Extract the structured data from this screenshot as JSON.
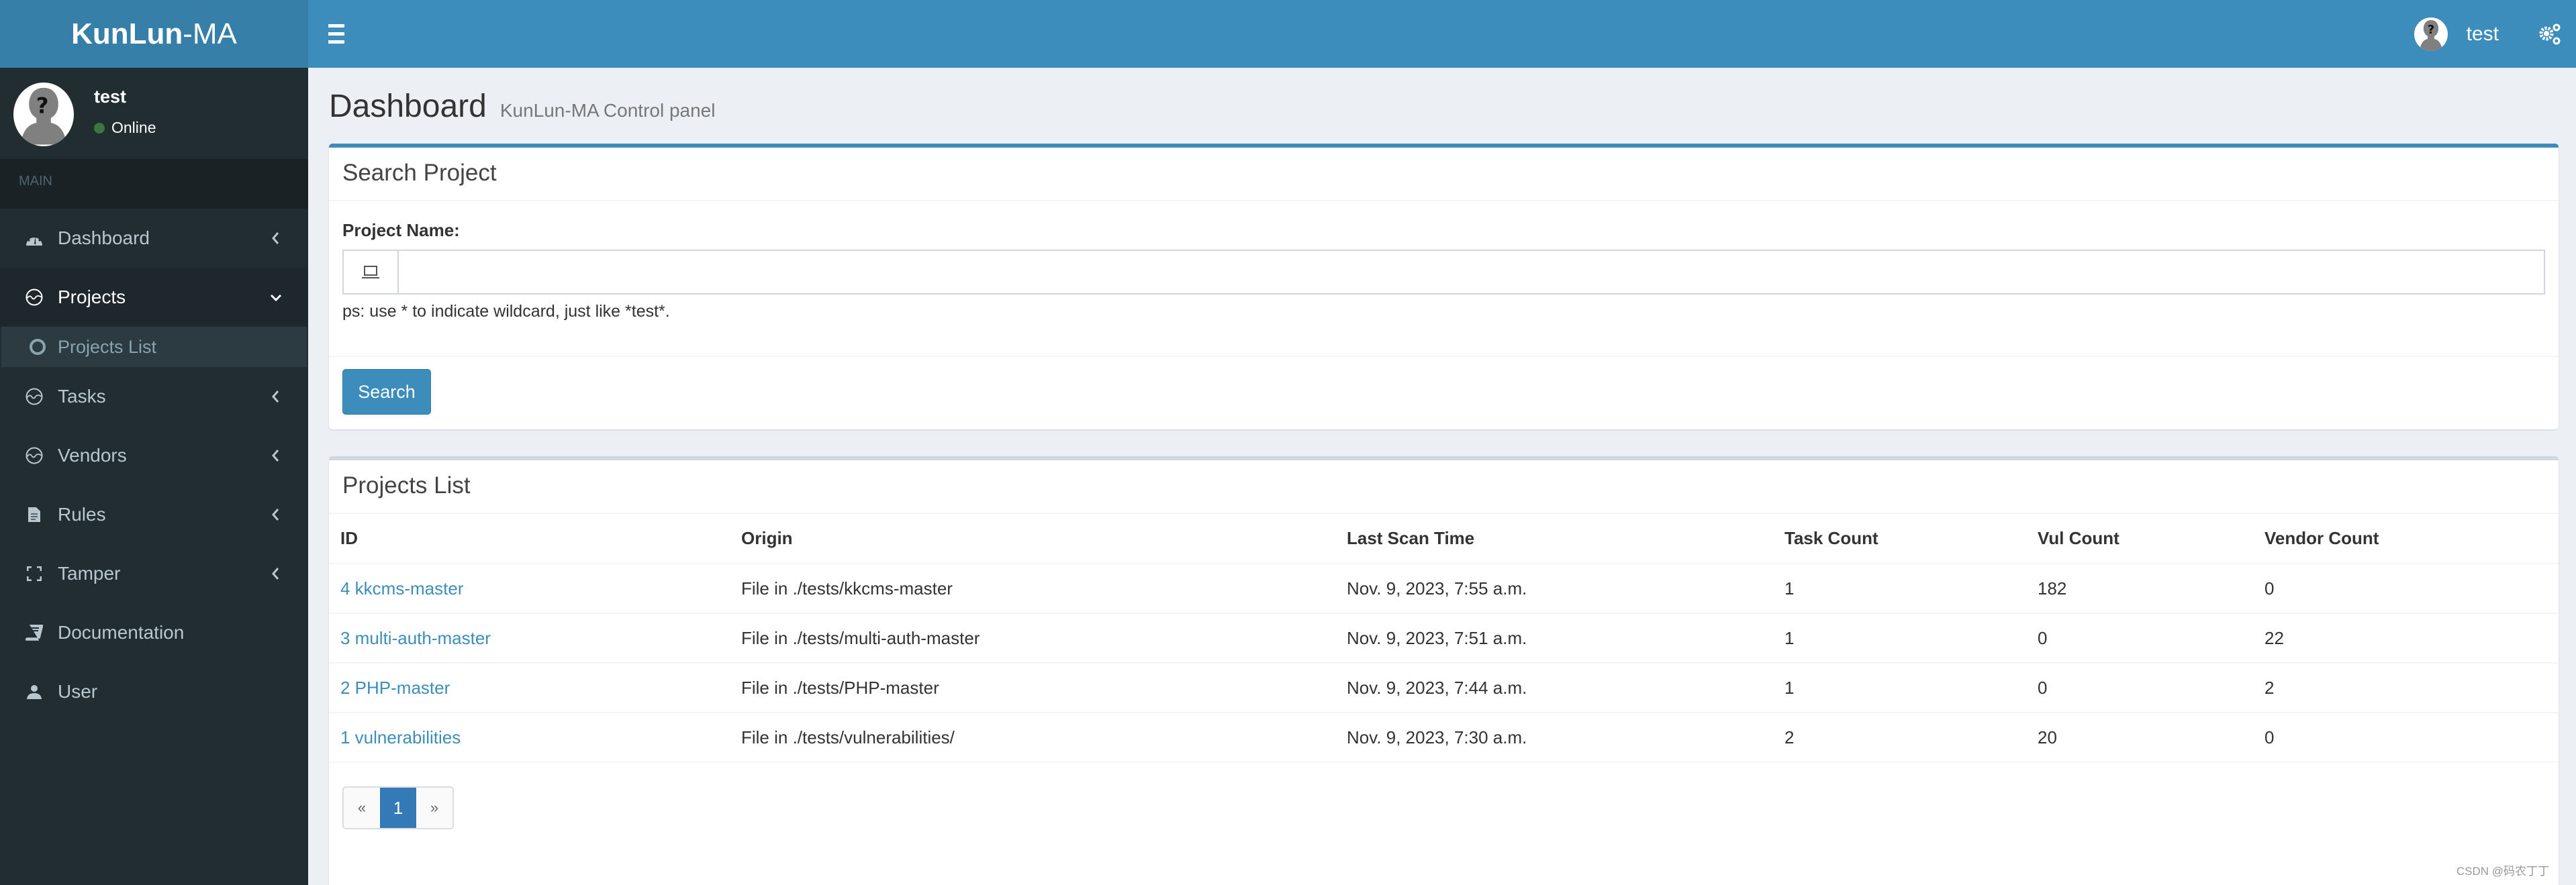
{
  "header": {
    "logo_bold": "KunLun",
    "logo_rest": "-MA",
    "username": "test",
    "menu_toggle_icon": "bars-icon",
    "settings_icon": "gears-icon"
  },
  "sidebar": {
    "user": {
      "name": "test",
      "status": "Online"
    },
    "section_header": "MAIN",
    "items": [
      {
        "label": "Dashboard",
        "icon": "dashboard-icon",
        "chevron": "left"
      },
      {
        "label": "Projects",
        "icon": "heartbeat-circle-icon",
        "chevron": "down",
        "active": true,
        "children": [
          {
            "label": "Projects List",
            "icon": "circle-icon"
          }
        ]
      },
      {
        "label": "Tasks",
        "icon": "heartbeat-circle-icon",
        "chevron": "left"
      },
      {
        "label": "Vendors",
        "icon": "heartbeat-circle-icon",
        "chevron": "left"
      },
      {
        "label": "Rules",
        "icon": "file-icon",
        "chevron": "left"
      },
      {
        "label": "Tamper",
        "icon": "fullscreen-icon",
        "chevron": "left"
      },
      {
        "label": "Documentation",
        "icon": "book-icon"
      },
      {
        "label": "User",
        "icon": "user-icon"
      }
    ]
  },
  "page": {
    "title": "Dashboard",
    "subtitle": "KunLun-MA Control panel"
  },
  "search_box": {
    "title": "Search Project",
    "field_label": "Project Name:",
    "input_value": "",
    "input_placeholder": "",
    "hint": "ps: use * to indicate wildcard, just like *test*.",
    "button_label": "Search"
  },
  "projects_box": {
    "title": "Projects List",
    "columns": [
      "ID",
      "Origin",
      "Last Scan Time",
      "Task Count",
      "Vul Count",
      "Vendor Count"
    ],
    "rows": [
      {
        "id": "4 kkcms-master",
        "origin": "File in ./tests/kkcms-master",
        "last_scan": "Nov. 9, 2023, 7:55 a.m.",
        "task_count": "1",
        "vul_count": "182",
        "vendor_count": "0"
      },
      {
        "id": "3 multi-auth-master",
        "origin": "File in ./tests/multi-auth-master",
        "last_scan": "Nov. 9, 2023, 7:51 a.m.",
        "task_count": "1",
        "vul_count": "0",
        "vendor_count": "22"
      },
      {
        "id": "2 PHP-master",
        "origin": "File in ./tests/PHP-master",
        "last_scan": "Nov. 9, 2023, 7:44 a.m.",
        "task_count": "1",
        "vul_count": "0",
        "vendor_count": "2"
      },
      {
        "id": "1 vulnerabilities",
        "origin": "File in ./tests/vulnerabilities/",
        "last_scan": "Nov. 9, 2023, 7:30 a.m.",
        "task_count": "2",
        "vul_count": "20",
        "vendor_count": "0"
      }
    ],
    "pagination": {
      "prev": "«",
      "current": "1",
      "next": "»"
    }
  },
  "watermark": "CSDN @码农丁丁",
  "colors": {
    "brand": "#3c8dbc",
    "logo_bg": "#367fa9",
    "sidebar_bg": "#222d32",
    "status_online": "#3c763d",
    "page_active": "#337ab7"
  }
}
